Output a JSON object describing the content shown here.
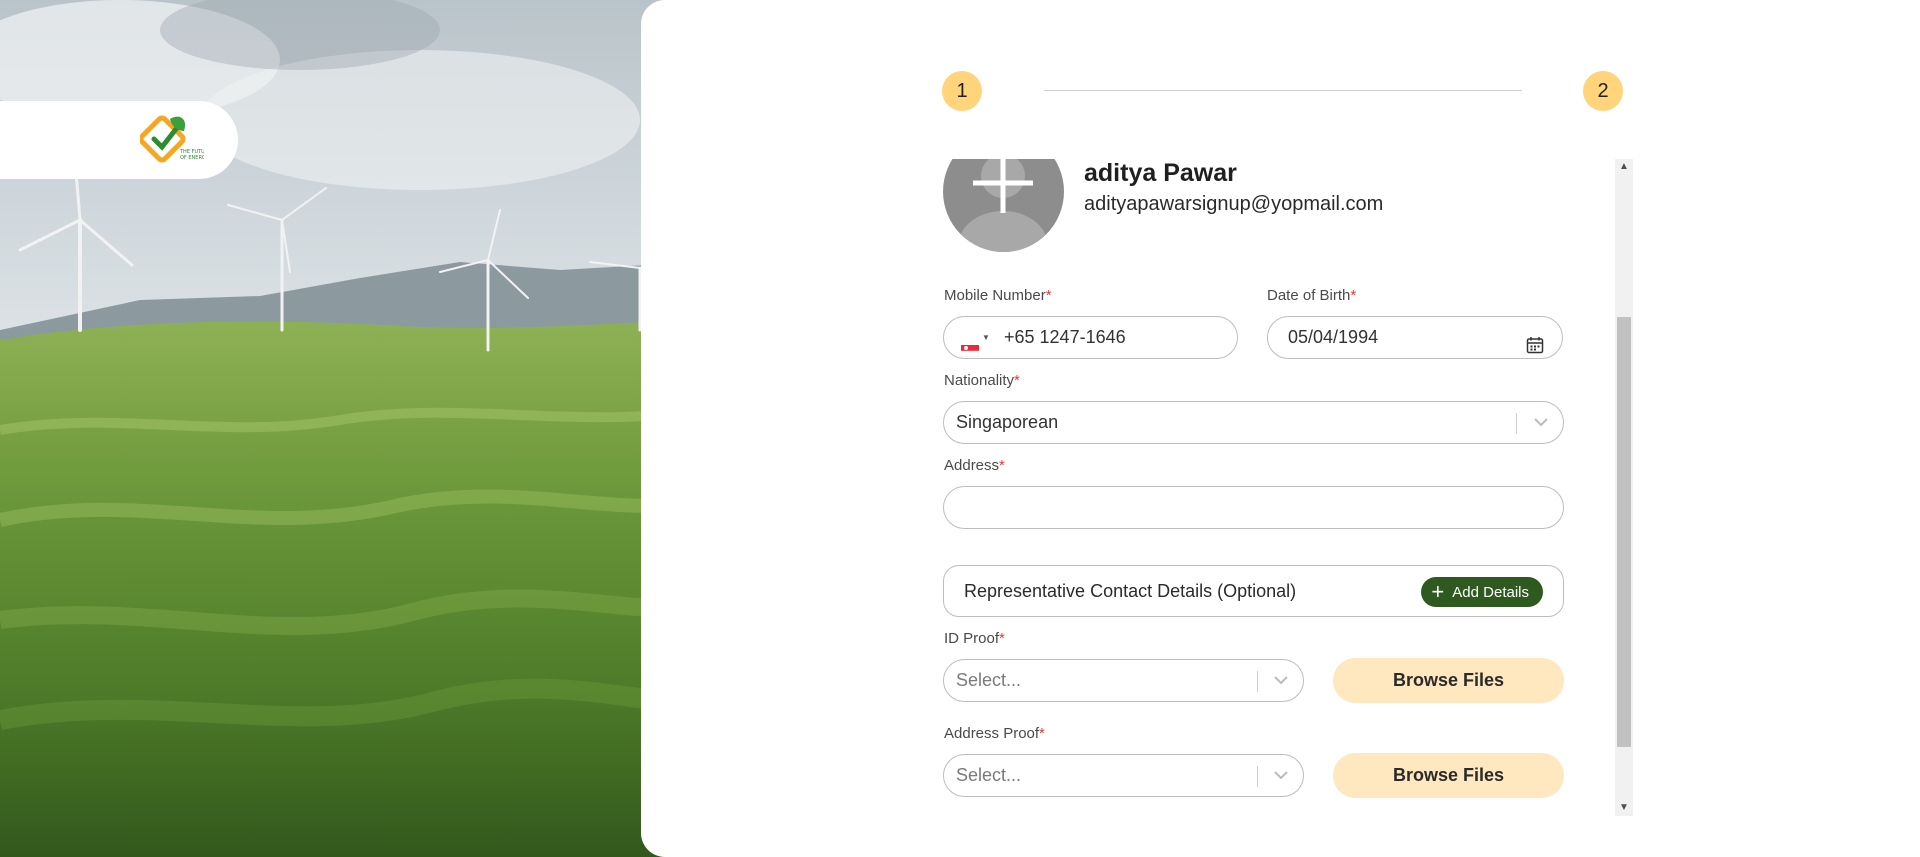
{
  "hero": {
    "logo_text": "THE FUTURE OF ENERGY INTELLIGENCE",
    "logo_brand": "GAB"
  },
  "stepper": {
    "step1": "1",
    "step2": "2"
  },
  "profile": {
    "name": "aditya Pawar",
    "email": "adityapawarsignup@yopmail.com"
  },
  "form": {
    "mobile": {
      "label": "Mobile Number",
      "required": "*",
      "value": "+65 1247-1646",
      "country_flag": "Singapore"
    },
    "dob": {
      "label": "Date of Birth",
      "required": "*",
      "value": "05/04/1994"
    },
    "nationality": {
      "label": "Nationality",
      "required": "*",
      "value": "Singaporean"
    },
    "address": {
      "label": "Address",
      "required": "*",
      "value": ""
    },
    "representative": {
      "label": "Representative Contact Details (Optional)",
      "button": "Add Details"
    },
    "id_proof": {
      "label": "ID Proof",
      "required": "*",
      "placeholder": "Select...",
      "browse": "Browse Files"
    },
    "address_proof": {
      "label": "Address Proof",
      "required": "*",
      "placeholder": "Select...",
      "browse": "Browse Files"
    }
  },
  "colors": {
    "accent_step": "#ffd47a",
    "browse_bg": "#ffe7bf",
    "add_btn": "#2f5a1f",
    "required": "#e53935"
  }
}
